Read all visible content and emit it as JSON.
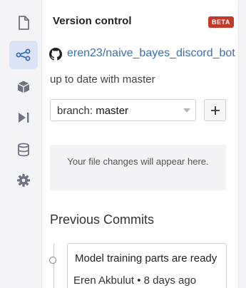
{
  "colors": {
    "accent": "#3b6fb6",
    "beta_badge": "#c0392b",
    "rail_active": "#dde3f6",
    "rail_bg": "#f4f4f6"
  },
  "rail": {
    "items": [
      {
        "icon": "file-icon",
        "active": false
      },
      {
        "icon": "version-control-icon",
        "active": true
      },
      {
        "icon": "package-icon",
        "active": false
      },
      {
        "icon": "run-icon",
        "active": false
      },
      {
        "icon": "database-icon",
        "active": false
      },
      {
        "icon": "gear-icon",
        "active": false
      }
    ]
  },
  "header": {
    "title": "Version control",
    "badge": "BETA"
  },
  "repo": {
    "icon": "github-icon",
    "name": "eren23/naive_bayes_discord_bot"
  },
  "status_text": "up to date with master",
  "branch": {
    "prefix": "branch: ",
    "selected": "master",
    "add_icon": "plus-icon"
  },
  "changes_placeholder": "Your file changes will appear here.",
  "commits": {
    "title": "Previous Commits",
    "items": [
      {
        "message": "Model training parts are ready",
        "meta": "Eren Akbulut • 8 days ago"
      }
    ]
  }
}
